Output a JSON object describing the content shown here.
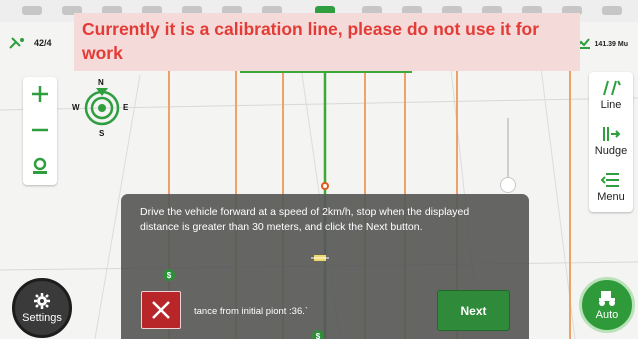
{
  "status": {
    "satellite_count": "42/4",
    "speed": "141.39 Mu"
  },
  "banner": {
    "message": "Currently it is a calibration line, please do not use it for work"
  },
  "compass": {
    "north": "N",
    "south": "S",
    "east": "E",
    "west": "W"
  },
  "toolbar": {
    "line_label": "Line",
    "nudge_label": "Nudge",
    "menu_label": "Menu"
  },
  "dialog": {
    "instruction": "Drive the vehicle forward at a speed of 2km/h, stop when the displayed distance is greater than 30 meters, and click the Next button.",
    "distance_text": "tance from initial piont :36.`",
    "next_label": "Next"
  },
  "markers": {
    "dollar": "$"
  },
  "bottom": {
    "settings_label": "Settings",
    "auto_label": "Auto"
  },
  "colors": {
    "accent_green": "#2f9a3a",
    "warning_red": "#e33b36",
    "banner_bg": "#f5dada",
    "guide_orange": "#f0a068",
    "path_green": "#3aa93a"
  }
}
